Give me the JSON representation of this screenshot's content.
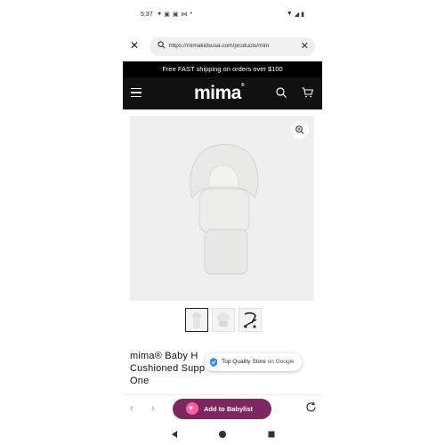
{
  "status_bar": {
    "time": "5:37",
    "notif_icons": [
      "bubble-icon",
      "instagram-icon",
      "instagram-icon",
      "share-icon",
      "dot-icon"
    ],
    "sys_icons": [
      "wifi-icon",
      "signal-icon",
      "battery-icon"
    ]
  },
  "browser": {
    "url": "https://mimakidsusa.com/products/mim"
  },
  "promo": {
    "text": "Free FAST shipping on orders over $100"
  },
  "header": {
    "logo": "mima",
    "logo_mark": "®"
  },
  "product": {
    "title_lines": [
      "mima® Baby H",
      "Cushioned Supp",
      "One"
    ],
    "image_bg": "#efefef"
  },
  "badge": {
    "text": "Top Quality Store",
    "suffix": "on Google"
  },
  "bottom": {
    "cta_label": "Add to Babylist",
    "cta_color": "#7b2760"
  }
}
